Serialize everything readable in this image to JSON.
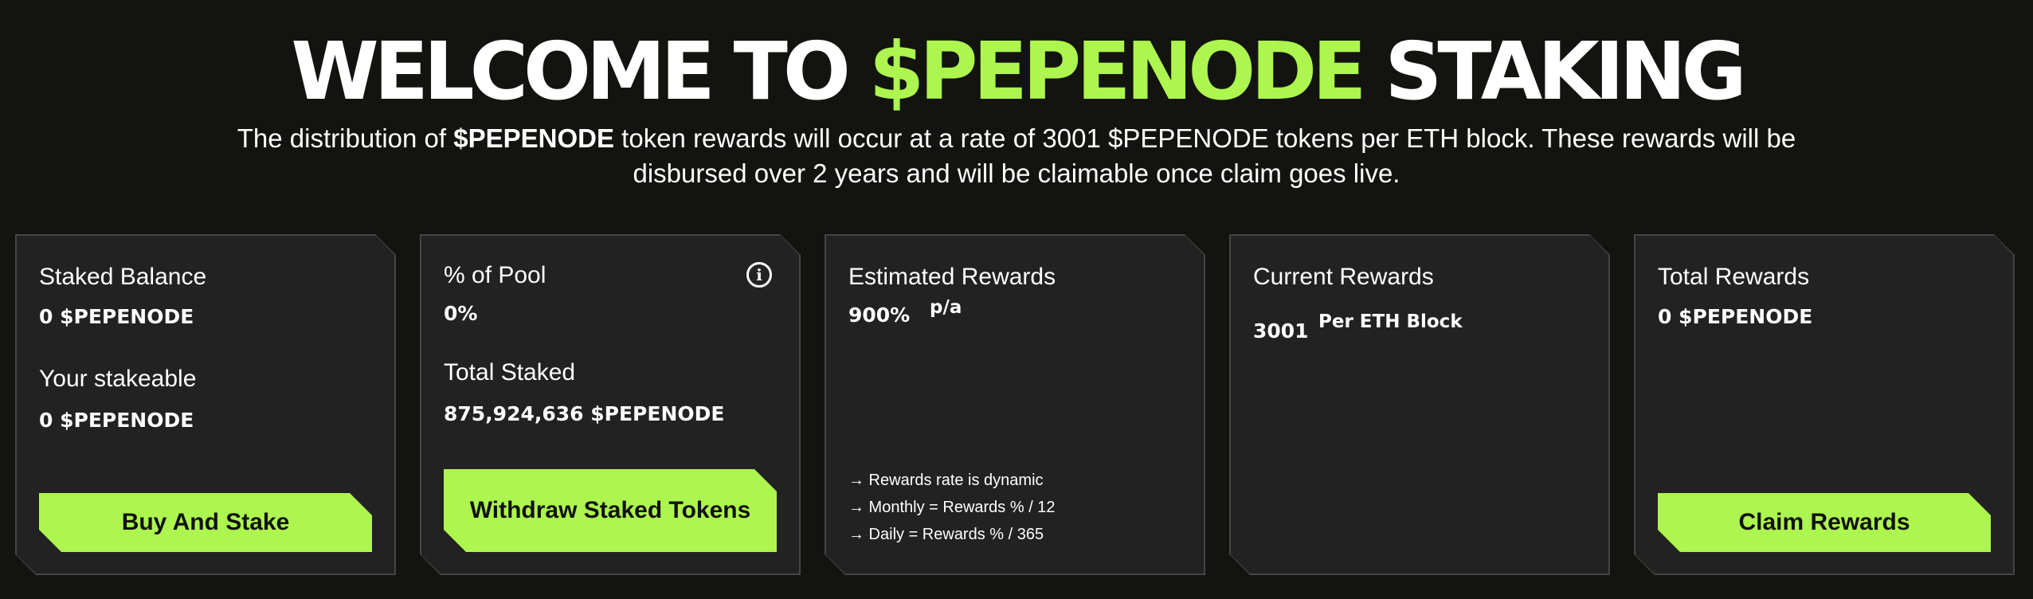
{
  "header": {
    "title_pre": "WELCOME TO ",
    "title_accent": "$PEPENODE",
    "title_post": " STAKING",
    "subtitle_pre": "The distribution of ",
    "subtitle_bold": "$PEPENODE",
    "subtitle_post": " token rewards will occur at a rate of 3001 $PEPENODE tokens per ETH block. These rewards will be disbursed over 2 years and will be claimable once claim goes live."
  },
  "colors": {
    "background": "#13140f",
    "accent": "#adf54f",
    "card": "#222222",
    "card_border": "#444544"
  },
  "cards": {
    "staked": {
      "label": "Staked Balance",
      "value": "0 $PEPENODE",
      "label2": "Your stakeable",
      "value2": "0 $PEPENODE",
      "button": "Buy And Stake"
    },
    "pool": {
      "label": "% of Pool",
      "value": "0%",
      "info_icon": "i",
      "label2": "Total Staked",
      "value2": "875,924,636 $PEPENODE",
      "button": "Withdraw Staked Tokens"
    },
    "estimated": {
      "label": "Estimated Rewards",
      "value": "900%",
      "suffix": "p/a",
      "notes": [
        "→ Rewards rate is dynamic",
        "→ Monthly = Rewards % / 12",
        "→ Daily = Rewards % / 365"
      ]
    },
    "current": {
      "label": "Current Rewards",
      "value": "3001",
      "suffix": "Per ETH Block"
    },
    "total": {
      "label": "Total Rewards",
      "value": "0 $PEPENODE",
      "button": "Claim Rewards"
    }
  }
}
